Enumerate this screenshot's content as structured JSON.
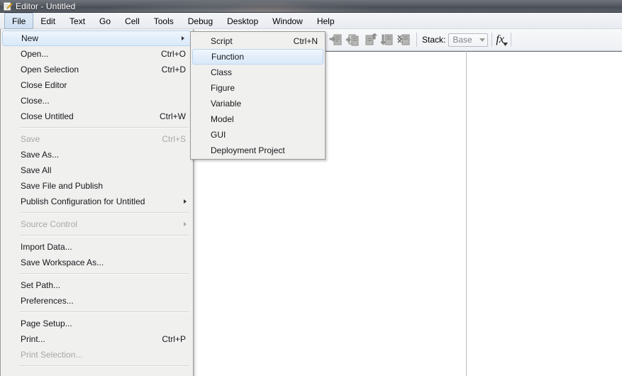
{
  "window": {
    "title": "Editor - Untitled",
    "icon": "editor-document-pencil-icon"
  },
  "menubar": {
    "items": [
      {
        "label": "File",
        "active": true
      },
      {
        "label": "Edit",
        "active": false
      },
      {
        "label": "Text",
        "active": false
      },
      {
        "label": "Go",
        "active": false
      },
      {
        "label": "Cell",
        "active": false
      },
      {
        "label": "Tools",
        "active": false
      },
      {
        "label": "Debug",
        "active": false
      },
      {
        "label": "Desktop",
        "active": false
      },
      {
        "label": "Window",
        "active": false
      },
      {
        "label": "Help",
        "active": false
      }
    ]
  },
  "toolbar": {
    "debug_buttons": [
      {
        "name": "step-icon",
        "enabled": false
      },
      {
        "name": "step-in-icon",
        "enabled": false
      },
      {
        "name": "step-out-icon",
        "enabled": false
      },
      {
        "name": "continue-icon",
        "enabled": false
      },
      {
        "name": "quit-debugging-icon",
        "enabled": false
      }
    ],
    "stack_label": "Stack:",
    "stack_value": "Base",
    "function_browser_label": "fx"
  },
  "file_menu": {
    "items": [
      {
        "label": "New",
        "accel": "",
        "submenu": true,
        "disabled": false,
        "highlighted": true
      },
      {
        "label": "Open...",
        "accel": "Ctrl+O",
        "submenu": false,
        "disabled": false,
        "highlighted": false
      },
      {
        "label": "Open Selection",
        "accel": "Ctrl+D",
        "submenu": false,
        "disabled": false,
        "highlighted": false
      },
      {
        "label": "Close Editor",
        "accel": "",
        "submenu": false,
        "disabled": false,
        "highlighted": false
      },
      {
        "label": "Close...",
        "accel": "",
        "submenu": false,
        "disabled": false,
        "highlighted": false
      },
      {
        "label": "Close Untitled",
        "accel": "Ctrl+W",
        "submenu": false,
        "disabled": false,
        "highlighted": false
      },
      {
        "separator": true
      },
      {
        "label": "Save",
        "accel": "Ctrl+S",
        "submenu": false,
        "disabled": true,
        "highlighted": false
      },
      {
        "label": "Save As...",
        "accel": "",
        "submenu": false,
        "disabled": false,
        "highlighted": false
      },
      {
        "label": "Save All",
        "accel": "",
        "submenu": false,
        "disabled": false,
        "highlighted": false
      },
      {
        "label": "Save File and Publish",
        "accel": "",
        "submenu": false,
        "disabled": false,
        "highlighted": false
      },
      {
        "label": "Publish Configuration for Untitled",
        "accel": "",
        "submenu": true,
        "disabled": false,
        "highlighted": false
      },
      {
        "separator": true
      },
      {
        "label": "Source Control",
        "accel": "",
        "submenu": true,
        "disabled": true,
        "highlighted": false
      },
      {
        "separator": true
      },
      {
        "label": "Import Data...",
        "accel": "",
        "submenu": false,
        "disabled": false,
        "highlighted": false
      },
      {
        "label": "Save Workspace As...",
        "accel": "",
        "submenu": false,
        "disabled": false,
        "highlighted": false
      },
      {
        "separator": true
      },
      {
        "label": "Set Path...",
        "accel": "",
        "submenu": false,
        "disabled": false,
        "highlighted": false
      },
      {
        "label": "Preferences...",
        "accel": "",
        "submenu": false,
        "disabled": false,
        "highlighted": false
      },
      {
        "separator": true
      },
      {
        "label": "Page Setup...",
        "accel": "",
        "submenu": false,
        "disabled": false,
        "highlighted": false
      },
      {
        "label": "Print...",
        "accel": "Ctrl+P",
        "submenu": false,
        "disabled": false,
        "highlighted": false
      },
      {
        "label": "Print Selection...",
        "accel": "",
        "submenu": false,
        "disabled": true,
        "highlighted": false
      },
      {
        "separator": true
      }
    ]
  },
  "new_submenu": {
    "items": [
      {
        "label": "Script",
        "accel": "Ctrl+N",
        "submenu": false,
        "disabled": false,
        "highlighted": false
      },
      {
        "label": "Function",
        "accel": "",
        "submenu": false,
        "disabled": false,
        "highlighted": true
      },
      {
        "label": "Class",
        "accel": "",
        "submenu": false,
        "disabled": false,
        "highlighted": false
      },
      {
        "label": "Figure",
        "accel": "",
        "submenu": false,
        "disabled": false,
        "highlighted": false
      },
      {
        "label": "Variable",
        "accel": "",
        "submenu": false,
        "disabled": false,
        "highlighted": false
      },
      {
        "label": "Model",
        "accel": "",
        "submenu": false,
        "disabled": false,
        "highlighted": false
      },
      {
        "label": "GUI",
        "accel": "",
        "submenu": false,
        "disabled": false,
        "highlighted": false
      },
      {
        "label": "Deployment Project",
        "accel": "",
        "submenu": false,
        "disabled": false,
        "highlighted": false
      }
    ]
  },
  "colors": {
    "menu_bg": "#f0f0ef",
    "highlight": "#dbe9f8",
    "titlebar": "#585c64",
    "editor_bg": "#ffffff"
  }
}
